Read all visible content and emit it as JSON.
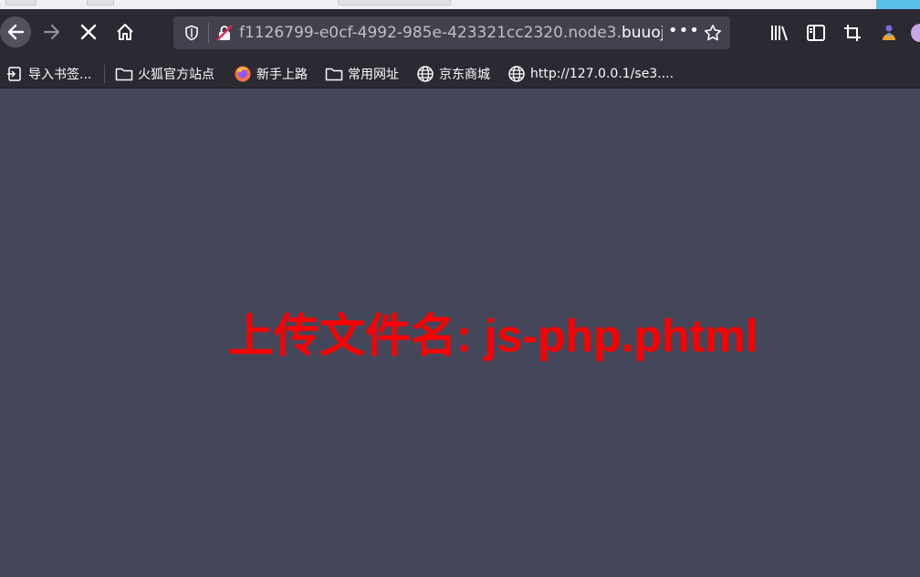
{
  "window": {
    "accent_colors": {
      "toolbar": "#2b2a33",
      "urlbar": "#42414d",
      "page_bg": "#44475a",
      "message": "#ff0000"
    }
  },
  "navigation": {
    "back_icon": "arrow-left-icon",
    "forward_icon": "arrow-right-icon",
    "stop_icon": "close-icon",
    "home_icon": "home-icon"
  },
  "urlbar": {
    "url_prefix": "f1126799-e0cf-4992-985e-423321cc2320.node3.",
    "url_domain": "buuoj.cn",
    "more_label": "•••"
  },
  "toolbar": {
    "icons": [
      "library-icon",
      "sidebar-icon",
      "crop-icon",
      "extension-icon",
      "account-icon"
    ]
  },
  "bookmarks": {
    "items": [
      {
        "label": "导入书签...",
        "icon": "import-icon"
      },
      {
        "label": "火狐官方站点",
        "icon": "folder-icon"
      },
      {
        "label": "新手上路",
        "icon": "firefox-icon"
      },
      {
        "label": "常用网址",
        "icon": "folder-icon"
      },
      {
        "label": "京东商城",
        "icon": "globe-icon"
      },
      {
        "label": "http://127.0.0.1/se3....",
        "icon": "globe-icon"
      }
    ]
  },
  "page": {
    "message": "上传文件名: js-php.phtml"
  }
}
